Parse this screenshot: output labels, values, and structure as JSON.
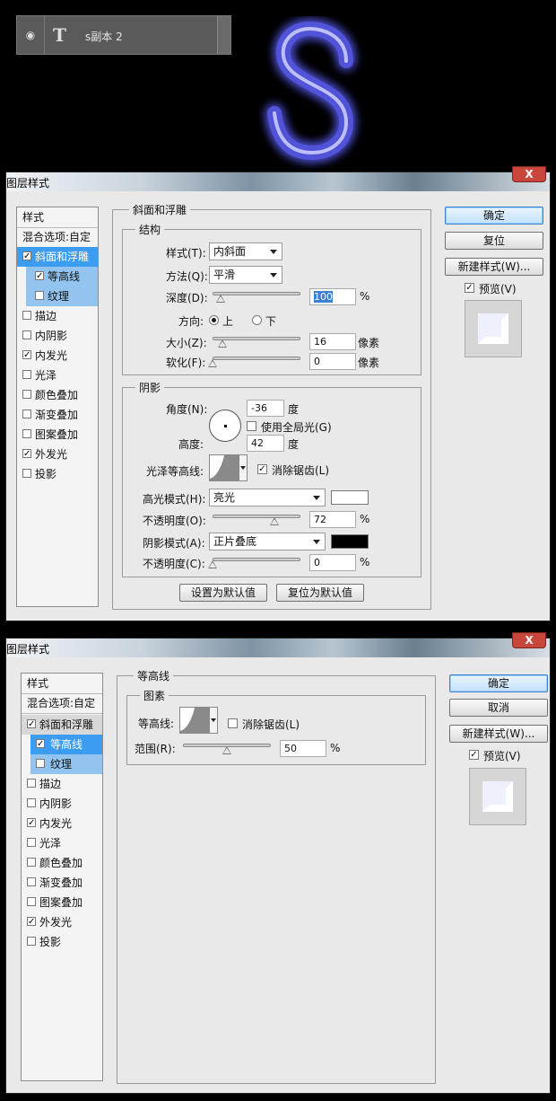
{
  "layer": {
    "name": "s副本 2"
  },
  "dialog1": {
    "title": "图层样式",
    "close": "X",
    "styles_header": "样式",
    "blend_options": "混合选项:自定",
    "items": [
      {
        "label": "斜面和浮雕",
        "checked": true
      },
      {
        "label": "等高线",
        "checked": true
      },
      {
        "label": "纹理",
        "checked": false
      },
      {
        "label": "描边",
        "checked": false
      },
      {
        "label": "内阴影",
        "checked": false
      },
      {
        "label": "内发光",
        "checked": true
      },
      {
        "label": "光泽",
        "checked": false
      },
      {
        "label": "颜色叠加",
        "checked": false
      },
      {
        "label": "渐变叠加",
        "checked": false
      },
      {
        "label": "图案叠加",
        "checked": false
      },
      {
        "label": "外发光",
        "checked": true
      },
      {
        "label": "投影",
        "checked": false
      }
    ],
    "section_title": "斜面和浮雕",
    "structure": {
      "title": "结构",
      "style_label": "样式(T):",
      "style_value": "内斜面",
      "technique_label": "方法(Q):",
      "technique_value": "平滑",
      "depth_label": "深度(D):",
      "depth_value": "100",
      "depth_unit": "%",
      "direction_label": "方向:",
      "dir_up": "上",
      "dir_down": "下",
      "size_label": "大小(Z):",
      "size_value": "16",
      "size_unit": "像素",
      "soften_label": "软化(F):",
      "soften_value": "0",
      "soften_unit": "像素"
    },
    "shading": {
      "title": "阴影",
      "angle_label": "角度(N):",
      "angle_value": "-36",
      "angle_unit": "度",
      "global_light": "使用全局光(G)",
      "altitude_label": "高度:",
      "altitude_value": "42",
      "altitude_unit": "度",
      "gloss_label": "光泽等高线:",
      "antialias": "消除锯齿(L)",
      "highlight_label": "高光模式(H):",
      "highlight_value": "亮光",
      "highlight_color": "#ffffff",
      "opacity1_label": "不透明度(O):",
      "opacity1_value": "72",
      "opacity1_unit": "%",
      "shadow_label": "阴影模式(A):",
      "shadow_value": "正片叠底",
      "shadow_color": "#000000",
      "opacity2_label": "不透明度(C):",
      "opacity2_value": "0",
      "opacity2_unit": "%"
    },
    "set_default": "设置为默认值",
    "reset_default": "复位为默认值",
    "ok": "确定",
    "reset": "复位",
    "new_style": "新建样式(W)...",
    "preview": "预览(V)"
  },
  "dialog2": {
    "title": "图层样式",
    "close": "X",
    "styles_header": "样式",
    "blend_options": "混合选项:自定",
    "section_title": "等高线",
    "elements_title": "图素",
    "contour_label": "等高线:",
    "antialias": "消除锯齿(L)",
    "range_label": "范围(R):",
    "range_value": "50",
    "range_unit": "%",
    "ok": "确定",
    "cancel": "取消",
    "new_style": "新建样式(W)...",
    "preview": "预览(V)"
  },
  "colors": {
    "glow": "#5a5cf0",
    "selected": "#3c9cf0",
    "sub_selected": "#92c4ef"
  }
}
